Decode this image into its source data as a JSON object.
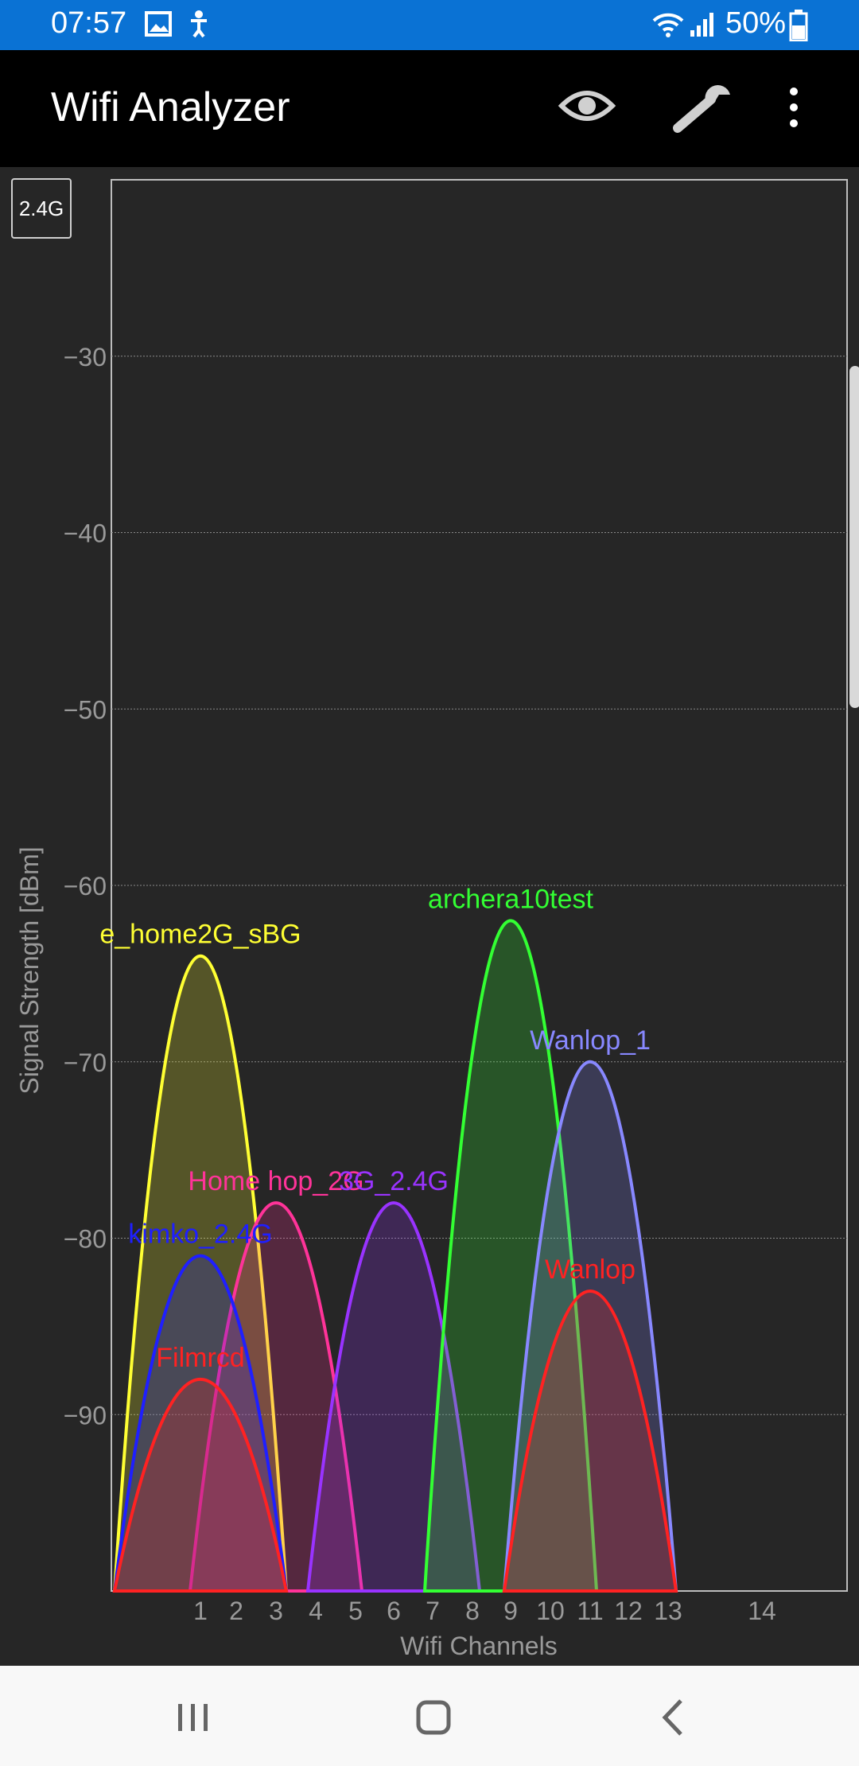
{
  "status_bar": {
    "time": "07:57",
    "battery": "50%"
  },
  "app_bar": {
    "title": "Wifi Analyzer"
  },
  "band_button": {
    "label": "2.4G"
  },
  "chart_data": {
    "type": "area",
    "xlabel": "Wifi Channels",
    "ylabel": "Signal Strength [dBm]",
    "ylim": [
      -100,
      -20
    ],
    "yticks": [
      -30,
      -40,
      -50,
      -60,
      -70,
      -80,
      -90
    ],
    "ytick_labels": [
      "−30",
      "−40",
      "−50",
      "−60",
      "−70",
      "−80",
      "−90"
    ],
    "xticks": [
      1,
      2,
      3,
      4,
      5,
      6,
      7,
      8,
      9,
      10,
      11,
      12,
      13,
      14
    ],
    "xtick_labels": [
      "1",
      "2",
      "3",
      "4",
      "5",
      "6",
      "7",
      "8",
      "9",
      "10",
      "11",
      "12",
      "13",
      "14"
    ],
    "grid": true,
    "series": [
      {
        "name": "e_home2G_sBG",
        "channel": 1,
        "peak": -64,
        "color": "#ffff33"
      },
      {
        "name": "Home hop_2G",
        "channel": 3,
        "peak": -78,
        "color": "#ff3399"
      },
      {
        "name": "3G_2.4G",
        "channel": 6,
        "peak": -78,
        "color": "#9933ff"
      },
      {
        "name": "kimko_2.4G",
        "channel": 1,
        "peak": -81,
        "color": "#1f1fff"
      },
      {
        "name": "Filmrcd",
        "channel": 1,
        "peak": -88,
        "color": "#ff2222"
      },
      {
        "name": "archera10test",
        "channel": 9,
        "peak": -62,
        "color": "#33ff33"
      },
      {
        "name": "Wanlop_1",
        "channel": 11,
        "peak": -70,
        "color": "#8888ff"
      },
      {
        "name": "Wanlop",
        "channel": 11,
        "peak": -83,
        "color": "#ff2222"
      }
    ]
  }
}
